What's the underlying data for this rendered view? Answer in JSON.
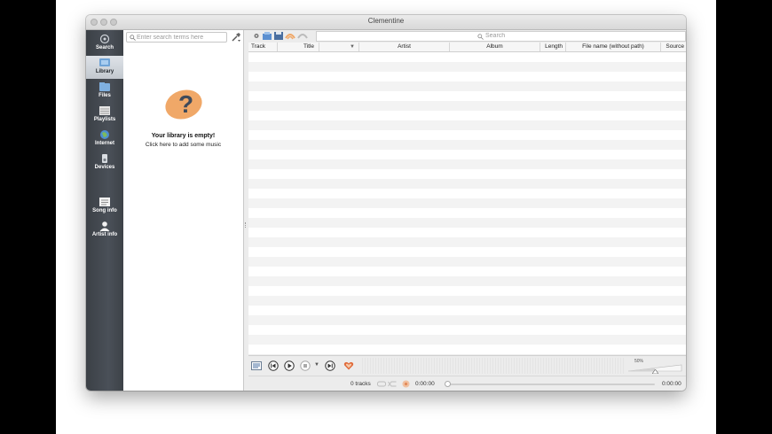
{
  "window": {
    "title": "Clementine"
  },
  "sidebar": {
    "items": [
      {
        "label": "Search",
        "icon": "search-icon"
      },
      {
        "label": "Library",
        "icon": "library-icon",
        "active": true
      },
      {
        "label": "Files",
        "icon": "files-icon"
      },
      {
        "label": "Playlists",
        "icon": "playlists-icon"
      },
      {
        "label": "Internet",
        "icon": "internet-icon"
      },
      {
        "label": "Devices",
        "icon": "devices-icon"
      },
      {
        "label": "Song info",
        "icon": "song-info-icon"
      },
      {
        "label": "Artist info",
        "icon": "artist-info-icon"
      }
    ]
  },
  "library": {
    "search_placeholder": "Enter search terms here",
    "empty_title": "Your library is empty!",
    "empty_subtitle": "Click here to add some music"
  },
  "playlist": {
    "search_placeholder": "Search",
    "columns": [
      "Track",
      "Title",
      "Artist",
      "Album",
      "Length",
      "File name (without path)",
      "Source"
    ],
    "rows": []
  },
  "player": {
    "volume_label": "50%",
    "volume_level": 0.5
  },
  "status": {
    "track_count": "0 tracks",
    "elapsed": "0:00:00",
    "total": "0:00:00"
  },
  "colors": {
    "sidebar_bg": "#454b52",
    "accent_orange": "#f0a868",
    "question_mark": "#3f4a5a"
  }
}
